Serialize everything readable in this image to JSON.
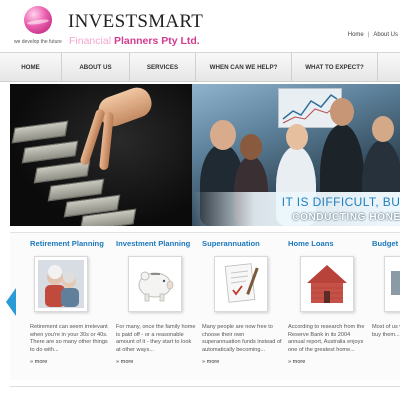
{
  "logo": {
    "name": "INVESTSMART",
    "subtitle_part1": "Financial",
    "subtitle_part2": "Planners Pty Ltd.",
    "tagline": "we develop the future"
  },
  "toplinks": {
    "home": "Home",
    "separator": "|",
    "about": "About Us"
  },
  "nav": [
    "HOME",
    "ABOUT US",
    "SERVICES",
    "WHEN CAN WE HELP?",
    "WHAT TO EXPECT?"
  ],
  "banner": {
    "line1": "IT IS DIFFICULT, BUT",
    "line2": "CONDUCTING HONES"
  },
  "services": [
    {
      "title": "Retirement Planning",
      "text": "Retirement can seem irrelevant when you're in your 30s or 40s. There are so many other things to do with...",
      "more": "» more",
      "icon": "elderly-couple-photo-icon"
    },
    {
      "title": "Investment Planning",
      "text": "For many, once the family home is paid off - or a reasonable amount of it - they start to look at other ways...",
      "more": "» more",
      "icon": "piggy-bank-icon"
    },
    {
      "title": "Superannuation",
      "text": "Many people are now free to choose their own superannuation funds instead of automatically becoming...",
      "more": "» more",
      "icon": "form-pen-icon"
    },
    {
      "title": "Home Loans",
      "text": "According to research from the Reserve Bank in its 2004 annual report, Australia enjoys one of the greatest home...",
      "more": "» more",
      "icon": "brick-house-icon"
    },
    {
      "title": "Budget",
      "text": "Most of us want put our of us t buy them...",
      "more": "",
      "icon": "budget-icon"
    }
  ],
  "colors": {
    "accent": "#1a78bd",
    "brand_pink": "#d23c8f",
    "arrow": "#2a9bd6"
  }
}
